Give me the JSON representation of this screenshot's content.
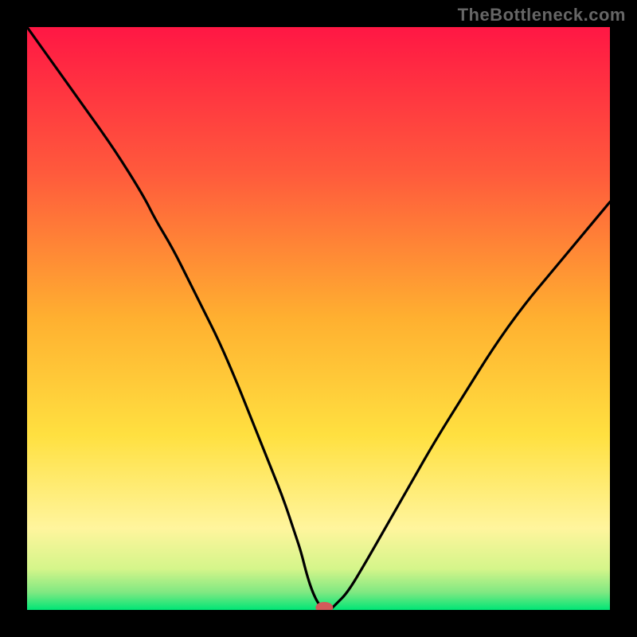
{
  "watermark": "TheBottleneck.com",
  "chart_data": {
    "type": "line",
    "title": "",
    "xlabel": "",
    "ylabel": "",
    "xlim": [
      0,
      100
    ],
    "ylim": [
      0,
      100
    ],
    "grid": false,
    "gradient_stops": [
      {
        "offset": 0,
        "color": "#ff1744"
      },
      {
        "offset": 0.25,
        "color": "#ff5a3c"
      },
      {
        "offset": 0.5,
        "color": "#ffb030"
      },
      {
        "offset": 0.7,
        "color": "#ffe040"
      },
      {
        "offset": 0.86,
        "color": "#fff59d"
      },
      {
        "offset": 0.93,
        "color": "#d4f58a"
      },
      {
        "offset": 0.97,
        "color": "#7fe882"
      },
      {
        "offset": 1.0,
        "color": "#00e676"
      }
    ],
    "series": [
      {
        "name": "bottleneck-curve",
        "color": "#000000",
        "x": [
          0,
          5,
          10,
          15,
          20,
          22,
          25,
          28,
          30,
          33,
          36,
          38,
          40,
          42,
          44,
          46,
          47,
          48,
          49,
          50,
          51,
          52,
          53,
          55,
          58,
          62,
          66,
          70,
          75,
          80,
          85,
          90,
          95,
          100
        ],
        "values": [
          100,
          93,
          86,
          79,
          71,
          67,
          62,
          56,
          52,
          46,
          39,
          34,
          29,
          24,
          19,
          13,
          10,
          6,
          3,
          1,
          0,
          0,
          1,
          3,
          8,
          15,
          22,
          29,
          37,
          45,
          52,
          58,
          64,
          70
        ]
      }
    ],
    "marker": {
      "x": 51,
      "y": 0,
      "color": "#d35a5a",
      "rx": 11,
      "ry": 7
    },
    "plateau": {
      "x_start": 50,
      "x_end": 52,
      "y": 0
    }
  }
}
